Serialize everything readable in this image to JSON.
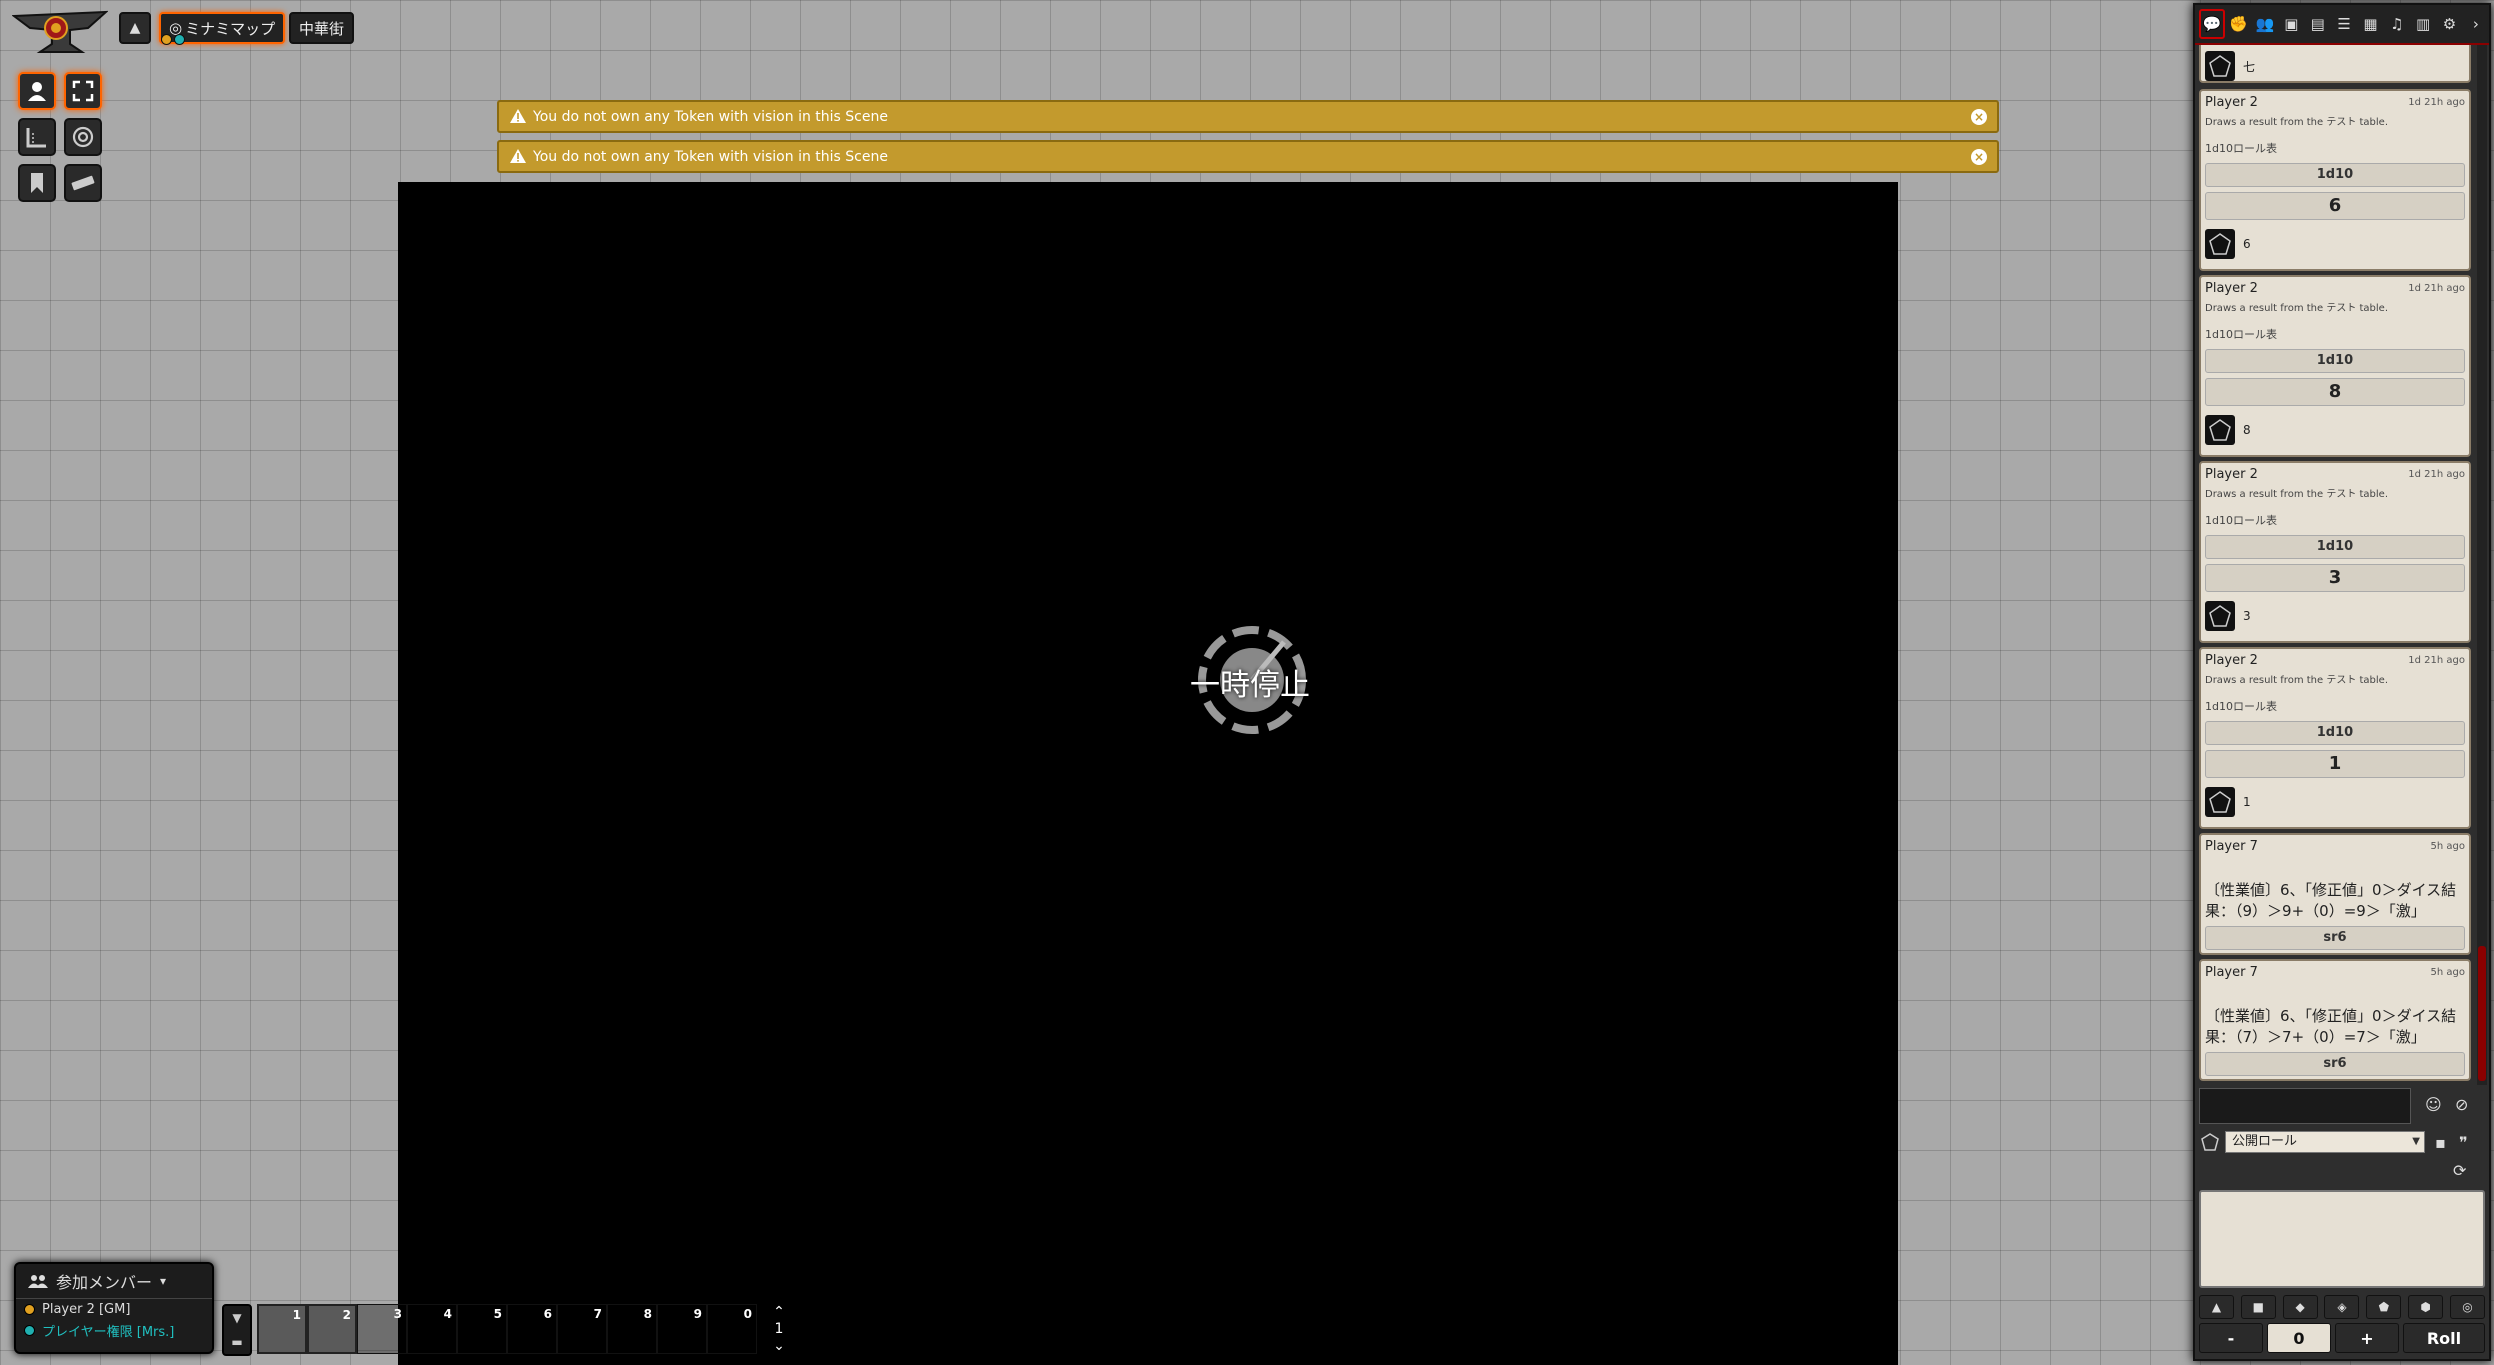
{
  "scene_nav": {
    "active_scene": "ミナミマップ",
    "other_scene": "中華街"
  },
  "notifications": [
    {
      "text": "You do not own any Token with vision in this Scene"
    },
    {
      "text": "You do not own any Token with vision in this Scene"
    }
  ],
  "pause_text": "一時停止",
  "players": {
    "title": "参加メンバー",
    "list": [
      {
        "name": "Player 2 [GM]",
        "color": "#e0a020"
      },
      {
        "name": "プレイヤー権限 [Mrs.]",
        "color": "#20b0b0"
      }
    ]
  },
  "hotbar": {
    "slots": [
      "1",
      "2",
      "3",
      "4",
      "5",
      "6",
      "7",
      "8",
      "9",
      "0"
    ],
    "page": "1"
  },
  "chat": {
    "top_partial_text": "七",
    "messages": [
      {
        "sender": "Player 2",
        "time": "1d 21h ago",
        "flavor": "Draws a result from the テスト table.",
        "table": "1d10ロール表",
        "formula": "1d10",
        "total": "6",
        "result": "6"
      },
      {
        "sender": "Player 2",
        "time": "1d 21h ago",
        "flavor": "Draws a result from the テスト table.",
        "table": "1d10ロール表",
        "formula": "1d10",
        "total": "8",
        "result": "8"
      },
      {
        "sender": "Player 2",
        "time": "1d 21h ago",
        "flavor": "Draws a result from the テスト table.",
        "table": "1d10ロール表",
        "formula": "1d10",
        "total": "3",
        "result": "3"
      },
      {
        "sender": "Player 2",
        "time": "1d 21h ago",
        "flavor": "Draws a result from the テスト table.",
        "table": "1d10ロール表",
        "formula": "1d10",
        "total": "1",
        "result": "1"
      }
    ],
    "text_messages": [
      {
        "sender": "Player 7",
        "time": "5h ago",
        "line1": "〔性業値〕6、「修正値」0＞ダイス結",
        "line2": "果：（9）＞9+（0）=9＞「激」",
        "formula": "sr6"
      },
      {
        "sender": "Player 7",
        "time": "5h ago",
        "line1": "〔性業値〕6、「修正値」0＞ダイス結",
        "line2": "果：（7）＞7+（0）=7＞「激」",
        "formula": "sr6"
      }
    ],
    "roll_mode": "公開ロール",
    "roll_minus": "-",
    "roll_value": "0",
    "roll_plus": "+",
    "roll_button": "Roll"
  },
  "colors": {
    "accent": "#ff6400",
    "notification": "#c39a2d",
    "sidebar_accent": "#8a0000"
  }
}
